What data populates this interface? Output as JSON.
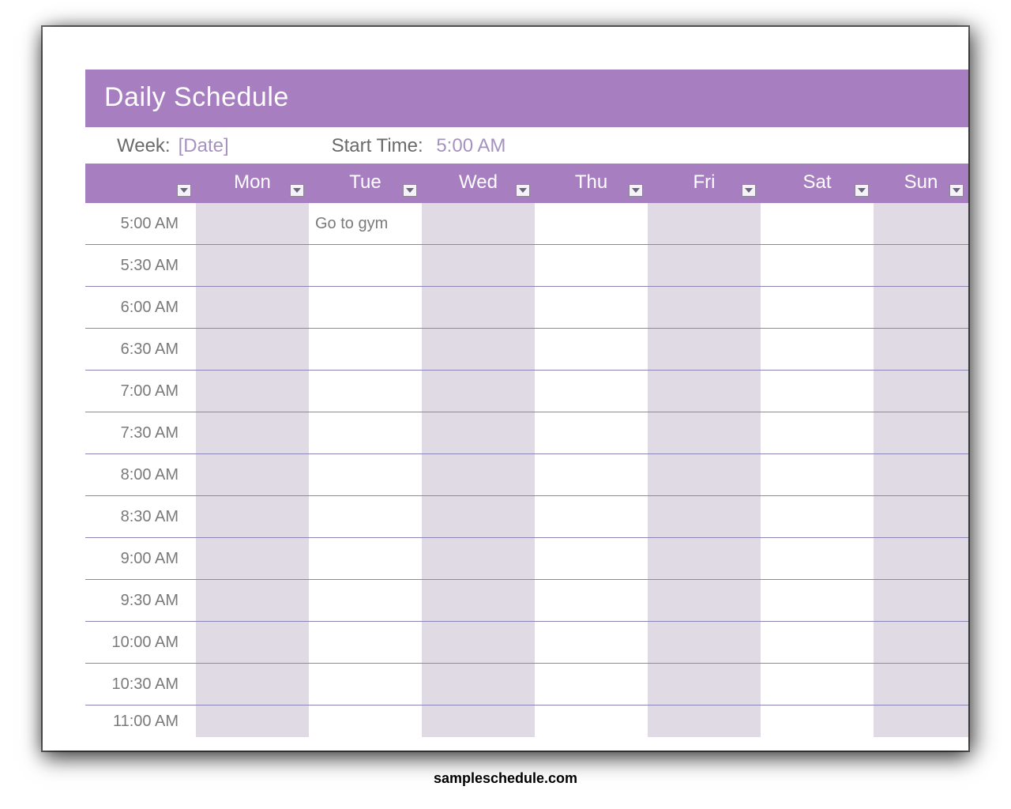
{
  "title": "Daily Schedule",
  "meta": {
    "week_label": "Week:",
    "week_value": "[Date]",
    "start_time_label": "Start Time:",
    "start_time_value": "5:00 AM"
  },
  "columns": [
    "",
    "Mon",
    "Tue",
    "Wed",
    "Thu",
    "Fri",
    "Sat",
    "Sun"
  ],
  "rows": [
    {
      "time": "5:00 AM",
      "cells": [
        "",
        "Go to gym",
        "",
        "",
        "",
        "",
        ""
      ]
    },
    {
      "time": "5:30 AM",
      "cells": [
        "",
        "",
        "",
        "",
        "",
        "",
        ""
      ]
    },
    {
      "time": "6:00 AM",
      "cells": [
        "",
        "",
        "",
        "",
        "",
        "",
        ""
      ]
    },
    {
      "time": "6:30 AM",
      "cells": [
        "",
        "",
        "",
        "",
        "",
        "",
        ""
      ]
    },
    {
      "time": "7:00 AM",
      "cells": [
        "",
        "",
        "",
        "",
        "",
        "",
        ""
      ]
    },
    {
      "time": "7:30 AM",
      "cells": [
        "",
        "",
        "",
        "",
        "",
        "",
        ""
      ]
    },
    {
      "time": "8:00 AM",
      "cells": [
        "",
        "",
        "",
        "",
        "",
        "",
        ""
      ]
    },
    {
      "time": "8:30 AM",
      "cells": [
        "",
        "",
        "",
        "",
        "",
        "",
        ""
      ]
    },
    {
      "time": "9:00 AM",
      "cells": [
        "",
        "",
        "",
        "",
        "",
        "",
        ""
      ]
    },
    {
      "time": "9:30 AM",
      "cells": [
        "",
        "",
        "",
        "",
        "",
        "",
        ""
      ]
    },
    {
      "time": "10:00 AM",
      "cells": [
        "",
        "",
        "",
        "",
        "",
        "",
        ""
      ]
    },
    {
      "time": "10:30 AM",
      "cells": [
        "",
        "",
        "",
        "",
        "",
        "",
        ""
      ]
    },
    {
      "time": "11:00 AM",
      "cells": [
        "",
        "",
        "",
        "",
        "",
        "",
        ""
      ],
      "partial": true
    }
  ],
  "watermark": "sampleschedule.com"
}
